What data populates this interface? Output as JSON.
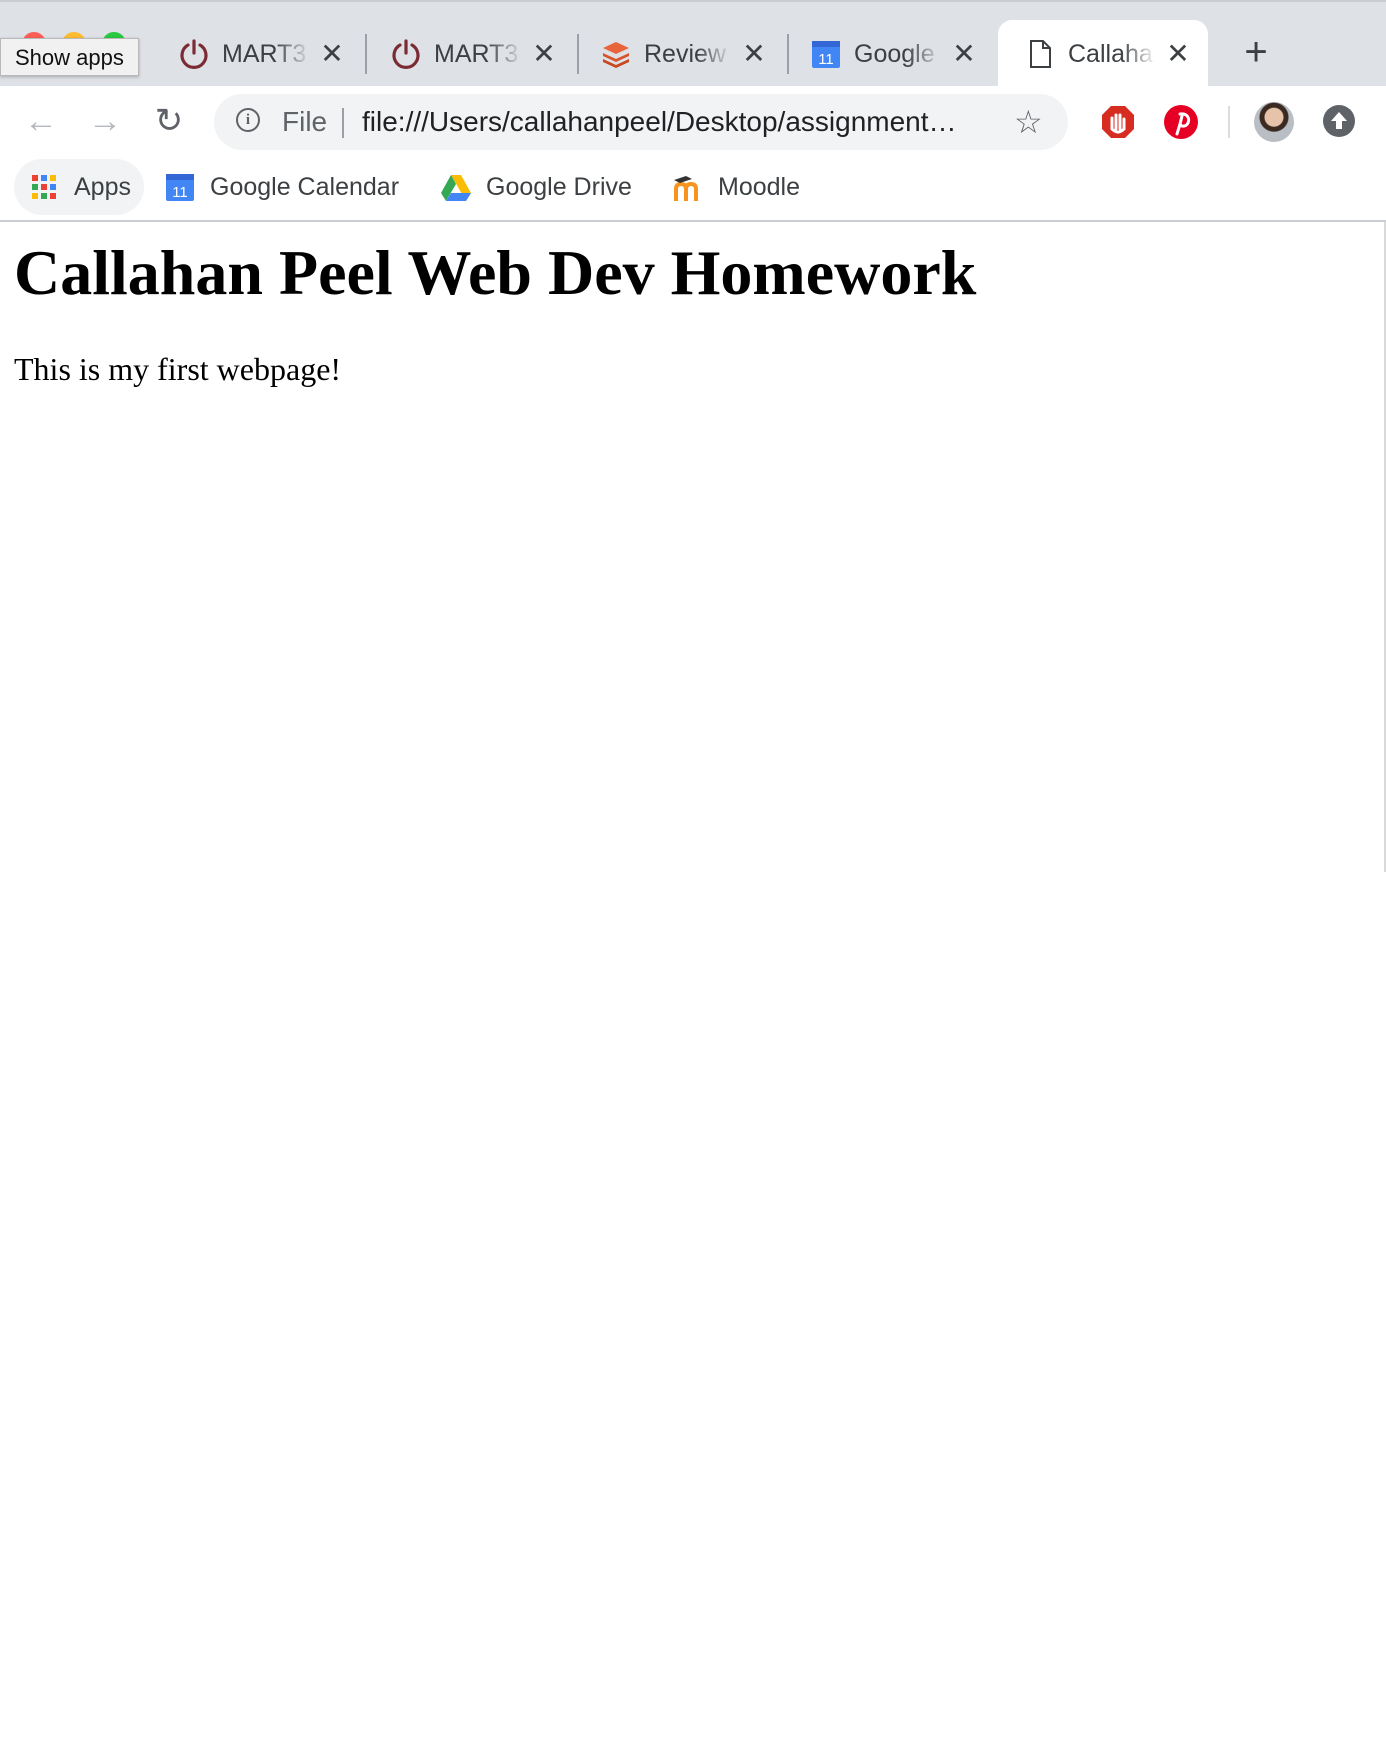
{
  "window": {
    "tooltip": "Show apps"
  },
  "tabs": [
    {
      "label": "MART3",
      "icon": "power-icon",
      "active": false
    },
    {
      "label": "MART3",
      "icon": "power-icon",
      "active": false
    },
    {
      "label": "Review",
      "icon": "layers-icon",
      "active": false
    },
    {
      "label": "Google",
      "icon": "calendar-icon",
      "active": false
    },
    {
      "label": "Callaha",
      "icon": "document-icon",
      "active": true
    }
  ],
  "toolbar": {
    "scheme_label": "File",
    "url": "file:///Users/callahanpeel/Desktop/assignment…"
  },
  "bookmarks": [
    {
      "label": "Apps",
      "icon": "apps-grid-icon"
    },
    {
      "label": "Google Calendar",
      "icon": "calendar-icon",
      "badge": "11"
    },
    {
      "label": "Google Drive",
      "icon": "drive-icon"
    },
    {
      "label": "Moodle",
      "icon": "moodle-icon"
    }
  ],
  "calendar_badge": "11",
  "page": {
    "title": "Callahan Peel Web Dev Homework",
    "paragraph": "This is my first webpage!"
  },
  "colors": {
    "tabstrip": "#dee1e6",
    "omnibox": "#f1f3f4",
    "text": "#3c4043",
    "power_icon": "#7b2b33",
    "pinterest": "#e60023"
  }
}
